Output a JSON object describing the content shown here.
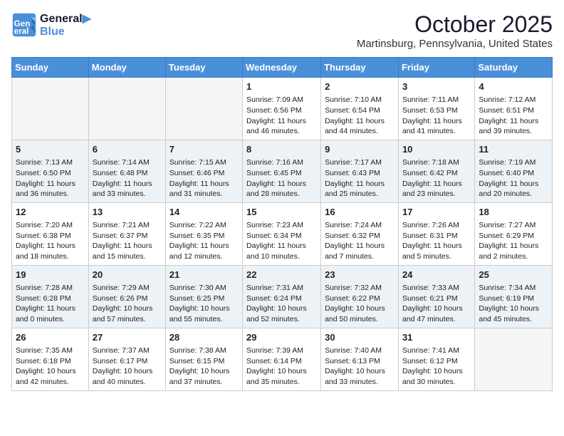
{
  "header": {
    "logo_line1": "General",
    "logo_line2": "Blue",
    "month": "October 2025",
    "location": "Martinsburg, Pennsylvania, United States"
  },
  "weekdays": [
    "Sunday",
    "Monday",
    "Tuesday",
    "Wednesday",
    "Thursday",
    "Friday",
    "Saturday"
  ],
  "weeks": [
    [
      {
        "day": "",
        "info": ""
      },
      {
        "day": "",
        "info": ""
      },
      {
        "day": "",
        "info": ""
      },
      {
        "day": "1",
        "info": "Sunrise: 7:09 AM\nSunset: 6:56 PM\nDaylight: 11 hours and 46 minutes."
      },
      {
        "day": "2",
        "info": "Sunrise: 7:10 AM\nSunset: 6:54 PM\nDaylight: 11 hours and 44 minutes."
      },
      {
        "day": "3",
        "info": "Sunrise: 7:11 AM\nSunset: 6:53 PM\nDaylight: 11 hours and 41 minutes."
      },
      {
        "day": "4",
        "info": "Sunrise: 7:12 AM\nSunset: 6:51 PM\nDaylight: 11 hours and 39 minutes."
      }
    ],
    [
      {
        "day": "5",
        "info": "Sunrise: 7:13 AM\nSunset: 6:50 PM\nDaylight: 11 hours and 36 minutes."
      },
      {
        "day": "6",
        "info": "Sunrise: 7:14 AM\nSunset: 6:48 PM\nDaylight: 11 hours and 33 minutes."
      },
      {
        "day": "7",
        "info": "Sunrise: 7:15 AM\nSunset: 6:46 PM\nDaylight: 11 hours and 31 minutes."
      },
      {
        "day": "8",
        "info": "Sunrise: 7:16 AM\nSunset: 6:45 PM\nDaylight: 11 hours and 28 minutes."
      },
      {
        "day": "9",
        "info": "Sunrise: 7:17 AM\nSunset: 6:43 PM\nDaylight: 11 hours and 25 minutes."
      },
      {
        "day": "10",
        "info": "Sunrise: 7:18 AM\nSunset: 6:42 PM\nDaylight: 11 hours and 23 minutes."
      },
      {
        "day": "11",
        "info": "Sunrise: 7:19 AM\nSunset: 6:40 PM\nDaylight: 11 hours and 20 minutes."
      }
    ],
    [
      {
        "day": "12",
        "info": "Sunrise: 7:20 AM\nSunset: 6:38 PM\nDaylight: 11 hours and 18 minutes."
      },
      {
        "day": "13",
        "info": "Sunrise: 7:21 AM\nSunset: 6:37 PM\nDaylight: 11 hours and 15 minutes."
      },
      {
        "day": "14",
        "info": "Sunrise: 7:22 AM\nSunset: 6:35 PM\nDaylight: 11 hours and 12 minutes."
      },
      {
        "day": "15",
        "info": "Sunrise: 7:23 AM\nSunset: 6:34 PM\nDaylight: 11 hours and 10 minutes."
      },
      {
        "day": "16",
        "info": "Sunrise: 7:24 AM\nSunset: 6:32 PM\nDaylight: 11 hours and 7 minutes."
      },
      {
        "day": "17",
        "info": "Sunrise: 7:26 AM\nSunset: 6:31 PM\nDaylight: 11 hours and 5 minutes."
      },
      {
        "day": "18",
        "info": "Sunrise: 7:27 AM\nSunset: 6:29 PM\nDaylight: 11 hours and 2 minutes."
      }
    ],
    [
      {
        "day": "19",
        "info": "Sunrise: 7:28 AM\nSunset: 6:28 PM\nDaylight: 11 hours and 0 minutes."
      },
      {
        "day": "20",
        "info": "Sunrise: 7:29 AM\nSunset: 6:26 PM\nDaylight: 10 hours and 57 minutes."
      },
      {
        "day": "21",
        "info": "Sunrise: 7:30 AM\nSunset: 6:25 PM\nDaylight: 10 hours and 55 minutes."
      },
      {
        "day": "22",
        "info": "Sunrise: 7:31 AM\nSunset: 6:24 PM\nDaylight: 10 hours and 52 minutes."
      },
      {
        "day": "23",
        "info": "Sunrise: 7:32 AM\nSunset: 6:22 PM\nDaylight: 10 hours and 50 minutes."
      },
      {
        "day": "24",
        "info": "Sunrise: 7:33 AM\nSunset: 6:21 PM\nDaylight: 10 hours and 47 minutes."
      },
      {
        "day": "25",
        "info": "Sunrise: 7:34 AM\nSunset: 6:19 PM\nDaylight: 10 hours and 45 minutes."
      }
    ],
    [
      {
        "day": "26",
        "info": "Sunrise: 7:35 AM\nSunset: 6:18 PM\nDaylight: 10 hours and 42 minutes."
      },
      {
        "day": "27",
        "info": "Sunrise: 7:37 AM\nSunset: 6:17 PM\nDaylight: 10 hours and 40 minutes."
      },
      {
        "day": "28",
        "info": "Sunrise: 7:38 AM\nSunset: 6:15 PM\nDaylight: 10 hours and 37 minutes."
      },
      {
        "day": "29",
        "info": "Sunrise: 7:39 AM\nSunset: 6:14 PM\nDaylight: 10 hours and 35 minutes."
      },
      {
        "day": "30",
        "info": "Sunrise: 7:40 AM\nSunset: 6:13 PM\nDaylight: 10 hours and 33 minutes."
      },
      {
        "day": "31",
        "info": "Sunrise: 7:41 AM\nSunset: 6:12 PM\nDaylight: 10 hours and 30 minutes."
      },
      {
        "day": "",
        "info": ""
      }
    ]
  ]
}
